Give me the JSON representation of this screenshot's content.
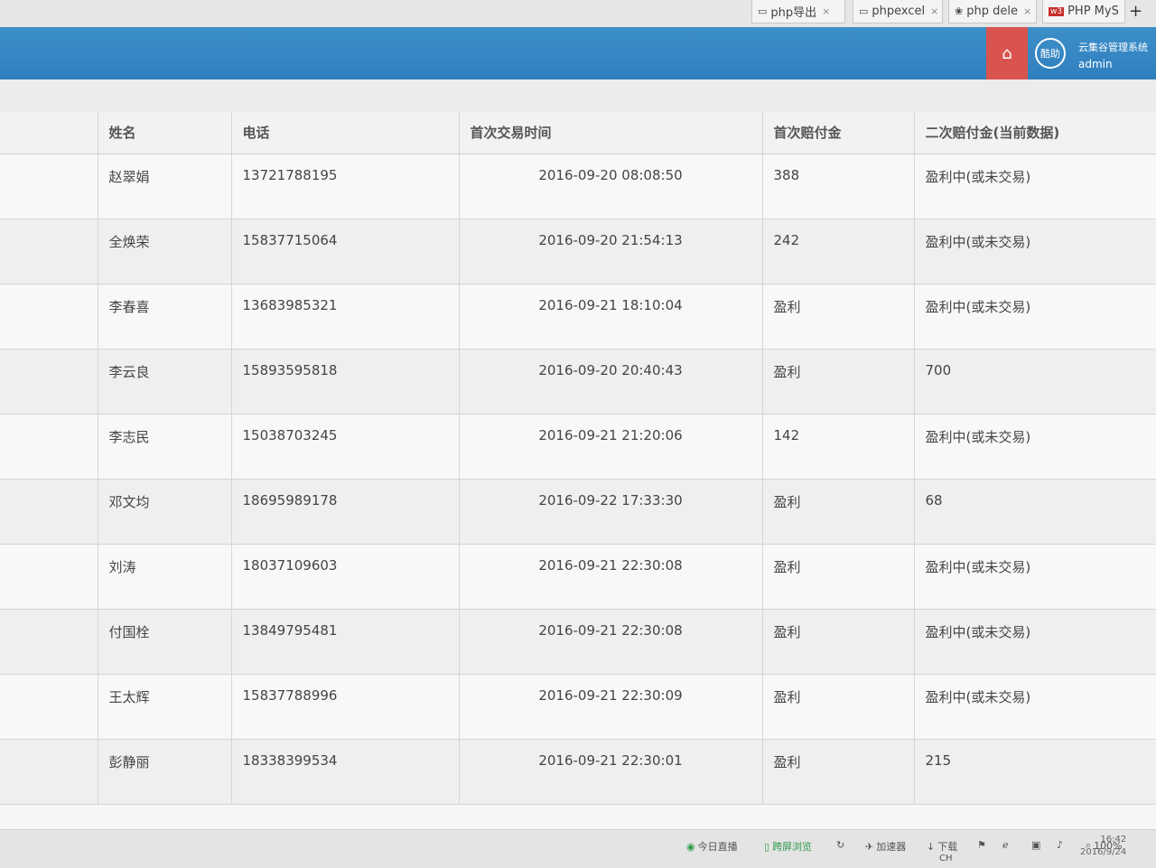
{
  "browser": {
    "tabs": [
      {
        "icon": "page-icon",
        "title": "php导出"
      },
      {
        "icon": "page-icon",
        "title": "phpexcel"
      },
      {
        "icon": "paw-icon",
        "title": "php dele"
      },
      {
        "icon": "w3-icon",
        "title": "PHP MyS"
      }
    ],
    "new_tab": "+"
  },
  "header": {
    "home_icon": "home-icon",
    "avatar_text": "酷助",
    "system_name": "云集谷管理系统",
    "user": "admin",
    "accent_color": "#2f7fbd",
    "home_color": "#d9534f"
  },
  "table": {
    "columns": [
      "姓名",
      "电话",
      "首次交易时间",
      "首次赔付金",
      "二次赔付金(当前数据)"
    ],
    "rows": [
      {
        "name": "赵翠娟",
        "phone": "13721788195",
        "time": "2016-09-20 08:08:50",
        "first": "388",
        "second": "盈利中(或未交易)"
      },
      {
        "name": "全焕荣",
        "phone": "15837715064",
        "time": "2016-09-20 21:54:13",
        "first": "242",
        "second": "盈利中(或未交易)"
      },
      {
        "name": "李春喜",
        "phone": "13683985321",
        "time": "2016-09-21 18:10:04",
        "first": "盈利",
        "second": "盈利中(或未交易)"
      },
      {
        "name": "李云良",
        "phone": "15893595818",
        "time": "2016-09-20 20:40:43",
        "first": "盈利",
        "second": "700"
      },
      {
        "name": "李志民",
        "phone": "15038703245",
        "time": "2016-09-21 21:20:06",
        "first": "142",
        "second": "盈利中(或未交易)"
      },
      {
        "name": "邓文均",
        "phone": "18695989178",
        "time": "2016-09-22 17:33:30",
        "first": "盈利",
        "second": "68"
      },
      {
        "name": "刘涛",
        "phone": "18037109603",
        "time": "2016-09-21 22:30:08",
        "first": "盈利",
        "second": "盈利中(或未交易)"
      },
      {
        "name": "付国栓",
        "phone": "13849795481",
        "time": "2016-09-21 22:30:08",
        "first": "盈利",
        "second": "盈利中(或未交易)"
      },
      {
        "name": "王太辉",
        "phone": "15837788996",
        "time": "2016-09-21 22:30:09",
        "first": "盈利",
        "second": "盈利中(或未交易)"
      },
      {
        "name": "彭静丽",
        "phone": "18338399534",
        "time": "2016-09-21 22:30:01",
        "first": "盈利",
        "second": "215"
      }
    ]
  },
  "statusbar": {
    "live": "今日直播",
    "cross_screen": "跨屏浏览",
    "accelerator": "加速器",
    "download": "下载",
    "zoom": "100%",
    "ime": "CH",
    "time": "16:42",
    "date": "2016/9/24"
  }
}
